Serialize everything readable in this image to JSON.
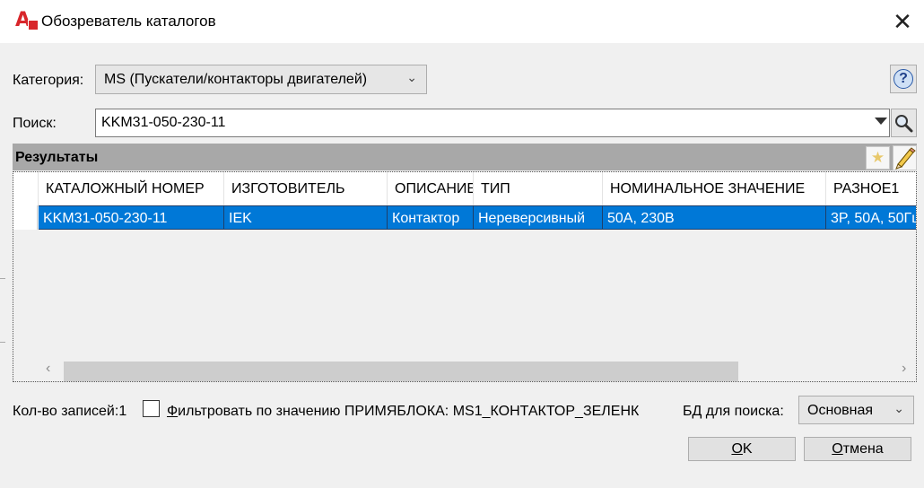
{
  "window": {
    "title": "Обозреватель каталогов",
    "close_glyph": "✕"
  },
  "category": {
    "label": "Категория:",
    "value": "MS (Пускатели/контакторы двигателей)",
    "chevron": "⌄"
  },
  "help": {
    "glyph": "?"
  },
  "search": {
    "label": "Поиск:",
    "value": "KKM31-050-230-11"
  },
  "results": {
    "title": "Результаты",
    "star_glyph": "★",
    "columns": [
      "КАТАЛОЖНЫЙ НОМЕР",
      "ИЗГОТОВИТЕЛЬ",
      "ОПИСАНИЕ",
      "ТИП",
      "НОМИНАЛЬНОЕ ЗНАЧЕНИЕ",
      "РАЗНОЕ1"
    ],
    "rows": [
      [
        "KKM31-050-230-11",
        "IEK",
        "Контактор",
        "Нереверсивный",
        "50A, 230B",
        "3P, 50A, 50Гц"
      ]
    ],
    "scroll_left": "‹",
    "scroll_right": "›"
  },
  "footer": {
    "records_label": "Кол-во записей:1",
    "filter_label_first": "Ф",
    "filter_label_rest": "ильтровать по значению ПРИМЯБЛОКА: MS1_КОНТАКТОР_ЗЕЛЕНК",
    "db_label": "БД для поиска:",
    "db_value": "Основная",
    "db_chevron": "⌄",
    "ok_first": "O",
    "ok_rest": "K",
    "cancel_first": "О",
    "cancel_rest": "тмена"
  },
  "colors": {
    "selection": "#0078d7",
    "results_header": "#a8a8a8",
    "app_icon": "#d8262b"
  }
}
